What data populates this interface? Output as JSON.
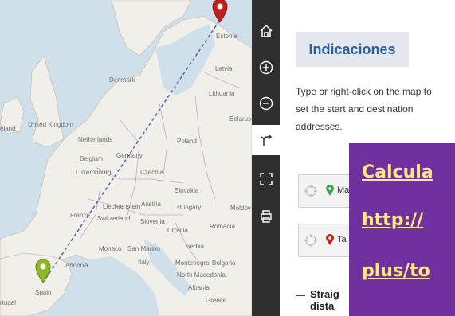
{
  "map": {
    "labels": {
      "estonia": "Estonia",
      "latvia": "Latvia",
      "lithuania": "Lithuania",
      "denmark": "Denmark",
      "belarus": "Belarus",
      "ireland": "eland",
      "uk": "United Kingdom",
      "netherlands": "Netherlands",
      "germany": "Germany",
      "poland": "Poland",
      "belgium": "Belgium",
      "luxembourg": "Luxembourg",
      "czechia": "Czechia",
      "slovakia": "Slovakia",
      "liechtenstein": "Liechtenstein",
      "austria": "Austria",
      "hungary": "Hungary",
      "moldova": "Moldov",
      "france": "France",
      "switzerland": "Switzerland",
      "slovenia": "Slovenia",
      "croatia": "Croatia",
      "romania": "Romania",
      "serbia": "Serbia",
      "monaco": "Monaco",
      "sanmarino": "San Marino",
      "andorra": "Andorra",
      "italy": "Italy",
      "montenegro": "Montenegro",
      "bulgaria": "Bulgaria",
      "northmacedonia": "North Macedonia",
      "albania": "Albania",
      "greece": "Greece",
      "spain": "Spain",
      "portugal": "rtugal"
    },
    "start_marker_color": "#8cb82a",
    "end_marker_color": "#c0201e"
  },
  "toolbar": {
    "icons": [
      "home-icon",
      "zoom-in-icon",
      "zoom-out-icon",
      "directions-icon",
      "fullscreen-icon",
      "print-icon"
    ]
  },
  "panel": {
    "title": "Indicaciones",
    "help_text": "Type or right-click on the map to set the start and destination addresses.",
    "start_value": "Ma",
    "destination_value": "Ta",
    "legend_line1": "Straig",
    "legend_line2": "dista"
  },
  "overlay": {
    "line1": "Calcula",
    "line2": "http://",
    "line3": "plus/to"
  },
  "colors": {
    "accent": "#2e5f9e",
    "overlay_bg": "#7030a0",
    "overlay_text": "#ffe97c",
    "toolbar_bg": "#2f2f2f"
  }
}
